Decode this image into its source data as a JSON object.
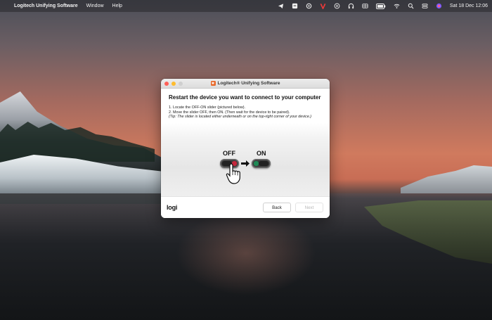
{
  "menubar": {
    "app_name": "Logitech Unifying Software",
    "menus": [
      "Window",
      "Help"
    ],
    "date_time": "Sat 18 Dec  12:06",
    "icons": [
      "telegram-icon",
      "archive-icon",
      "at-icon",
      "vivaldi-icon",
      "play-icon",
      "headphones-icon",
      "grid-icon",
      "battery-icon",
      "wifi-icon",
      "search-icon",
      "control-center-icon",
      "siri-icon"
    ]
  },
  "window": {
    "title": "Logitech® Unifying Software",
    "heading": "Restart the device you want to connect to your computer",
    "steps": [
      "1. Locate the OFF-ON slider (pictured below).",
      "2. Move the slider OFF, then ON. (Then wait for the device to be paired)."
    ],
    "tip": "(Tip: The slider is located either underneath or on the top-right corner of your device.)",
    "illustration": {
      "off_label": "OFF",
      "on_label": "ON"
    },
    "logo": "logi",
    "buttons": {
      "back": "Back",
      "next": "Next"
    }
  },
  "colors": {
    "close": "#fe5f57",
    "minimize": "#febc2e",
    "off_red": "#c5263b",
    "on_green": "#1f8a56"
  }
}
